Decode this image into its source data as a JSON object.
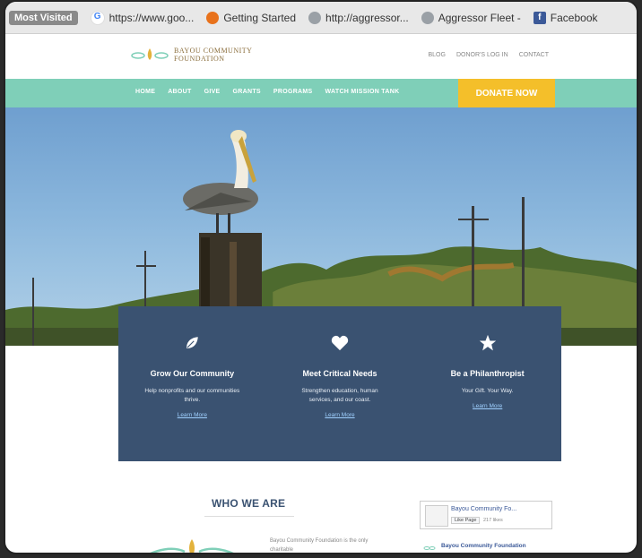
{
  "bookmarks": [
    {
      "label": "Most Visited",
      "icon": "most-visited-badge"
    },
    {
      "label": "https://www.goo...",
      "icon": "google-icon"
    },
    {
      "label": "Getting Started",
      "icon": "firefox-icon"
    },
    {
      "label": "http://aggressor...",
      "icon": "globe-icon"
    },
    {
      "label": "Aggressor Fleet -",
      "icon": "globe-icon"
    },
    {
      "label": "Facebook",
      "icon": "facebook-icon"
    }
  ],
  "site": {
    "logo_line1": "BAYOU COMMUNITY",
    "logo_line2": "FOUNDATION",
    "top_links": [
      "BLOG",
      "DONOR'S LOG IN",
      "CONTACT"
    ],
    "nav": [
      "HOME",
      "ABOUT",
      "GIVE",
      "GRANTS",
      "PROGRAMS",
      "WATCH MISSION TANK"
    ],
    "donate_label": "DONATE NOW"
  },
  "features": [
    {
      "icon": "leaf-icon",
      "title": "Grow Our Community",
      "desc": "Help nonprofits and our communities thrive.",
      "link": "Learn More"
    },
    {
      "icon": "heart-icon",
      "title": "Meet Critical Needs",
      "desc": "Strengthen education, human services, and our coast.",
      "link": "Learn More"
    },
    {
      "icon": "star-icon",
      "title": "Be a Philanthropist",
      "desc": "Your Gift. Your Way.",
      "link": "Learn More"
    }
  ],
  "who": {
    "title": "WHO WE ARE",
    "text": "Bayou Community Foundation is the only charitable"
  },
  "facebook": {
    "page_name": "Bayou Community Fo...",
    "like_label": "Like Page",
    "like_count": "217 likes",
    "post_name": "Bayou Community Foundation"
  },
  "colors": {
    "nav_bg": "#7fcfb8",
    "donate_bg": "#f4bf2a",
    "panel_bg": "#3a5271"
  }
}
